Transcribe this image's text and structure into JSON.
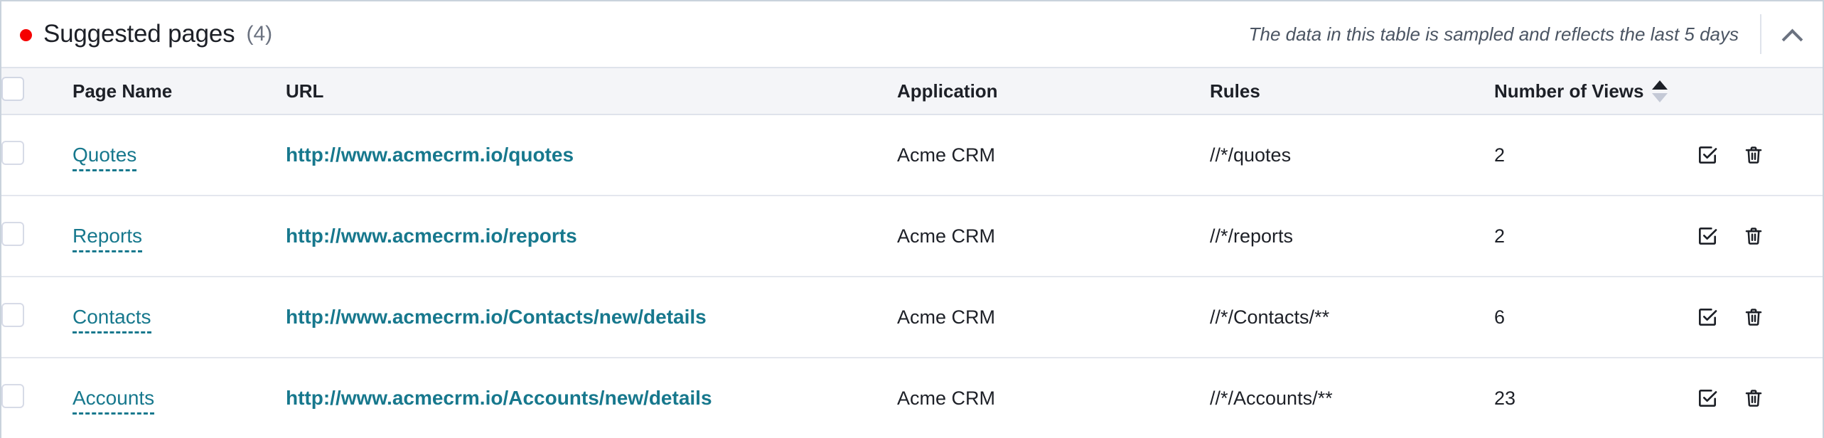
{
  "header": {
    "status_dot_color": "#f50000",
    "title": "Suggested pages",
    "count": "(4)",
    "note": "The data in this table is sampled and reflects the last 5 days",
    "collapse_icon": "chevron-up-icon"
  },
  "table": {
    "columns": [
      {
        "key": "select",
        "label": ""
      },
      {
        "key": "name",
        "label": "Page Name"
      },
      {
        "key": "url",
        "label": "URL"
      },
      {
        "key": "app",
        "label": "Application"
      },
      {
        "key": "rules",
        "label": "Rules"
      },
      {
        "key": "views",
        "label": "Number of Views"
      },
      {
        "key": "actions",
        "label": ""
      }
    ],
    "sort": {
      "column": "Number of Views",
      "direction": "asc"
    },
    "select_all_checked": false,
    "row_actions": [
      {
        "name": "approve-button",
        "icon": "checkbox-check-icon"
      },
      {
        "name": "delete-button",
        "icon": "trash-icon"
      }
    ],
    "rows": [
      {
        "checked": false,
        "name": "Quotes",
        "url": "http://www.acmecrm.io/quotes",
        "app": "Acme CRM",
        "rules": "//*/quotes",
        "views": "2"
      },
      {
        "checked": false,
        "name": "Reports",
        "url": "http://www.acmecrm.io/reports",
        "app": "Acme CRM",
        "rules": "//*/reports",
        "views": "2"
      },
      {
        "checked": false,
        "name": "Contacts",
        "url": "http://www.acmecrm.io/Contacts/new/details",
        "app": "Acme CRM",
        "rules": "//*/Contacts/**",
        "views": "6"
      },
      {
        "checked": false,
        "name": "Accounts",
        "url": "http://www.acmecrm.io/Accounts/new/details",
        "app": "Acme CRM",
        "rules": "//*/Accounts/**",
        "views": "23"
      }
    ]
  },
  "colors": {
    "link": "#17788d",
    "text": "#1d2027",
    "muted": "#6b7280",
    "header_bg": "#f4f5f8",
    "border": "#dfe3eb"
  }
}
